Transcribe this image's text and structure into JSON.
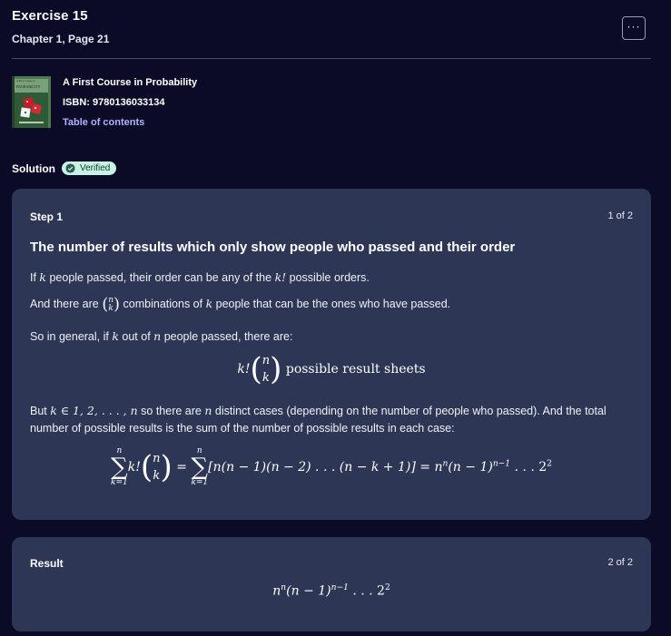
{
  "header": {
    "title": "Exercise 15",
    "subtitle": "Chapter 1, Page 21",
    "more_label": "···"
  },
  "book": {
    "cover_top_text": "A First Course in",
    "cover_title": "PROBABILITY",
    "title": "A First Course in Probability",
    "isbn": "ISBN: 9780136033134",
    "toc_label": "Table of contents"
  },
  "solution": {
    "label": "Solution",
    "badge": "Verified"
  },
  "step1": {
    "label": "Step 1",
    "count": "1 of 2",
    "heading": "The number of results which only show people who passed and their order",
    "p1_a": "If ",
    "p1_k": "k",
    "p1_b": " people passed, their order can be any of the ",
    "p1_kf": "k!",
    "p1_c": " possible orders.",
    "p2_a": "And there are ",
    "p2_b": " combinations of ",
    "p2_k": "k",
    "p2_c": " people that can be the ones who have passed.",
    "p3_a": "So in general, if ",
    "p3_k": "k",
    "p3_b": " out of ",
    "p3_n": "n",
    "p3_c": " people passed, there are:",
    "eq1_text": "possible result sheets",
    "p4_a": "But ",
    "p4_math": "k ∈ 1, 2, . . . , n",
    "p4_b": " so there are ",
    "p4_n": "n",
    "p4_c": " distinct cases (depending on the number of people who passed). And the total number of possible results is the sum of the number of possible results in each case:",
    "eq2_mid": "[n(n − 1)(n − 2) . . . (n − k + 1)] = n",
    "eq2_tail": "(n − 1)",
    "eq2_end": " . . . 2"
  },
  "result": {
    "label": "Result",
    "count": "2 of 2",
    "expr_a": "n",
    "expr_b": "(n − 1)",
    "expr_c": " . . . 2"
  },
  "colors": {
    "background": "#0b0b28",
    "card": "#2d3654",
    "link": "#b0b3ff",
    "badge": "#c7f5e3"
  }
}
